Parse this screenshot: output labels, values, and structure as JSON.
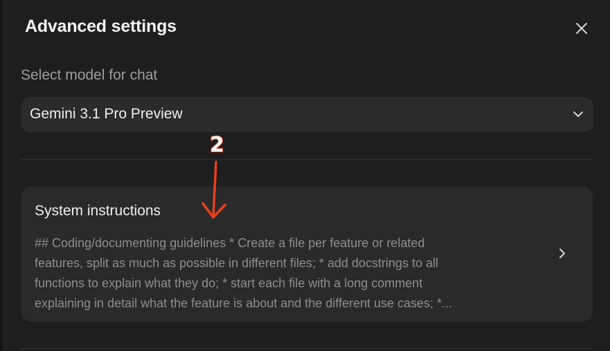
{
  "dialog": {
    "title": "Advanced settings"
  },
  "model_section": {
    "label": "Select model for chat",
    "selected_value": "Gemini 3.1 Pro Preview"
  },
  "system_instructions": {
    "title": "System instructions",
    "lines": [
      "## Coding/documenting guidelines * Create a file per feature or related",
      "features, split as much as possible in different files; * add docstrings to all",
      "functions to explain what they do; * start each file with a long comment",
      "explaining in detail what the feature is about and the different use cases; *..."
    ]
  },
  "annotation": {
    "number": "2",
    "color": "#e8401e"
  },
  "icons": {
    "close": "close-icon",
    "dropdown": "chevron-down-icon",
    "open": "chevron-right-icon"
  }
}
